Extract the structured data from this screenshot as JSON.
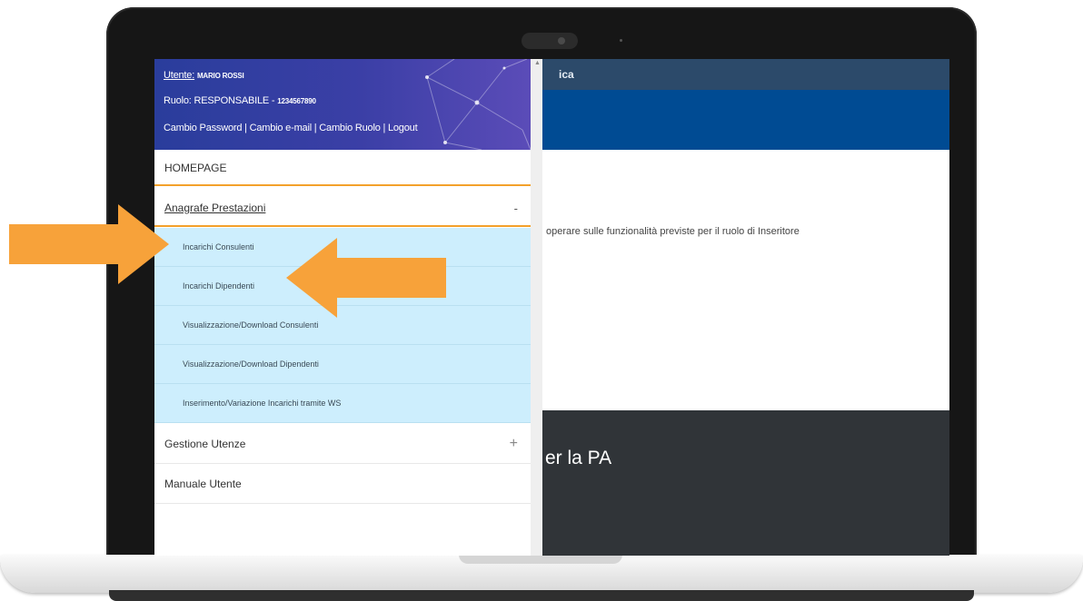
{
  "app": {
    "topbar_text": "ica",
    "body_text": "operare sulle funzionalità previste per il ruolo di Inseritore",
    "footer_text": "er la PA"
  },
  "user": {
    "user_label": "Utente:",
    "user_name": "MARIO ROSSI",
    "role_label": "Ruolo:",
    "role_value": "RESPONSABILE -",
    "role_code": "1234567890",
    "links_text": "Cambio Password | Cambio e-mail | Cambio Ruolo | Logout"
  },
  "menu": {
    "home": "HOMEPAGE",
    "anagrafe": "Anagrafe Prestazioni",
    "anagrafe_toggle": "-",
    "sub_items": [
      "Incarichi Consulenti",
      "Incarichi Dipendenti",
      "Visualizzazione/Download Consulenti",
      "Visualizzazione/Download Dipendenti",
      "Inserimento/Variazione Incarichi tramite WS"
    ],
    "gestione": "Gestione Utenze",
    "gestione_toggle": "+",
    "manuale": "Manuale Utente"
  },
  "colors": {
    "arrow": "#f7a23a",
    "submenu_bg": "#cdeefd",
    "header_gradient_start": "#2a3d9c",
    "active_border": "#f3a12b"
  },
  "icons": {
    "arrow_1": "right-arrow-icon",
    "arrow_2": "left-arrow-icon"
  }
}
